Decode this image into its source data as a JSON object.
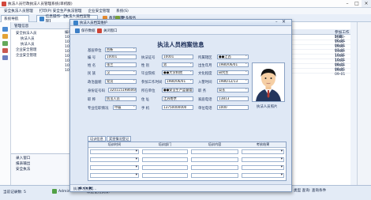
{
  "window": {
    "title": "执法人员行政执法人员管理系统(单机版)"
  },
  "menu": [
    "安全执法人员管理",
    "打印(P) 安全生产执法管理",
    "企业安全管理",
    "系统(S)"
  ],
  "toolbar": {
    "system_nav": "系统导航",
    "tab_label": "信息操作-【执法人员档案管理】",
    "tab_cont": "教育指南",
    "more": "更多服务"
  },
  "nav": {
    "title": "管理信息",
    "items": [
      "安全执法人员",
      "执法人员",
      "执法人员",
      "企业安全管理",
      "企业安全管理"
    ],
    "bottom": [
      "录入窗口",
      "报表输出"
    ],
    "footer": "安全执法"
  },
  "list": {
    "col_num": "编号",
    "col_date": "参加工作时间",
    "dates": [
      "1980-06-01",
      "1980-08-01",
      "1980-07-01",
      "1980-10-01",
      "1984-10-01",
      "1983-08-01",
      "1983-08-01",
      "1985-09-01"
    ]
  },
  "statusbar": {
    "left": "当前记录数: 5",
    "user": "Admin",
    "welcome": "欢迎使用执法!",
    "right": "类型  查询: 查询条件"
  },
  "dialog": {
    "title": "执法人员档案维护",
    "save": "保存数据",
    "close": "关闭窗口",
    "heading": "执法人员档案信息",
    "fields": {
      "dept_label": "基层单位",
      "dept": "台新",
      "no_label": "编    号",
      "no": "10001",
      "cert_label": "执法证号",
      "cert": "10001",
      "area_label": "所属辖区",
      "area": "●●江西",
      "name_label": "姓    名",
      "name": "张三",
      "sex_label": "性    别",
      "sex": "男",
      "birth_label": "出生年月",
      "birth": "1980/06/01",
      "nation_label": "民    族",
      "nation": "汉",
      "edu_label": "毕业院校",
      "edu": "●●大学和院",
      "culture_label": "文化程度",
      "culture": "研究生",
      "party_label": "政治面貌",
      "party": "党员",
      "work_label": "参加工作时间",
      "work": "1980/06/01",
      "join_label": "入警时间",
      "join": "1986/12/13",
      "id_label": "身份证号码",
      "id": "320115198606050012",
      "unit_label": "所在单位",
      "unit": "●●安全生产监督管理局",
      "duty_label": "职    务",
      "duty": "局长",
      "post_label": "职    称",
      "post": "执法人员",
      "home_label": "住    址",
      "home": "江苏南京",
      "tel_label": "家庭电话",
      "tel": "13813",
      "office_label": "专业任职情况",
      "office": "中级",
      "mobile_label": "手    机",
      "mobile": "13750000000",
      "unittel_label": "单位电话",
      "unittel": "1000",
      "photo_label": "执法人员照片"
    },
    "subtabs": [
      "培训信息",
      "奖惩情况登记"
    ],
    "grid_cols": [
      "培训时间",
      "培训部门",
      "培训内容",
      "考核结果"
    ],
    "record": "执法人员档案..."
  }
}
